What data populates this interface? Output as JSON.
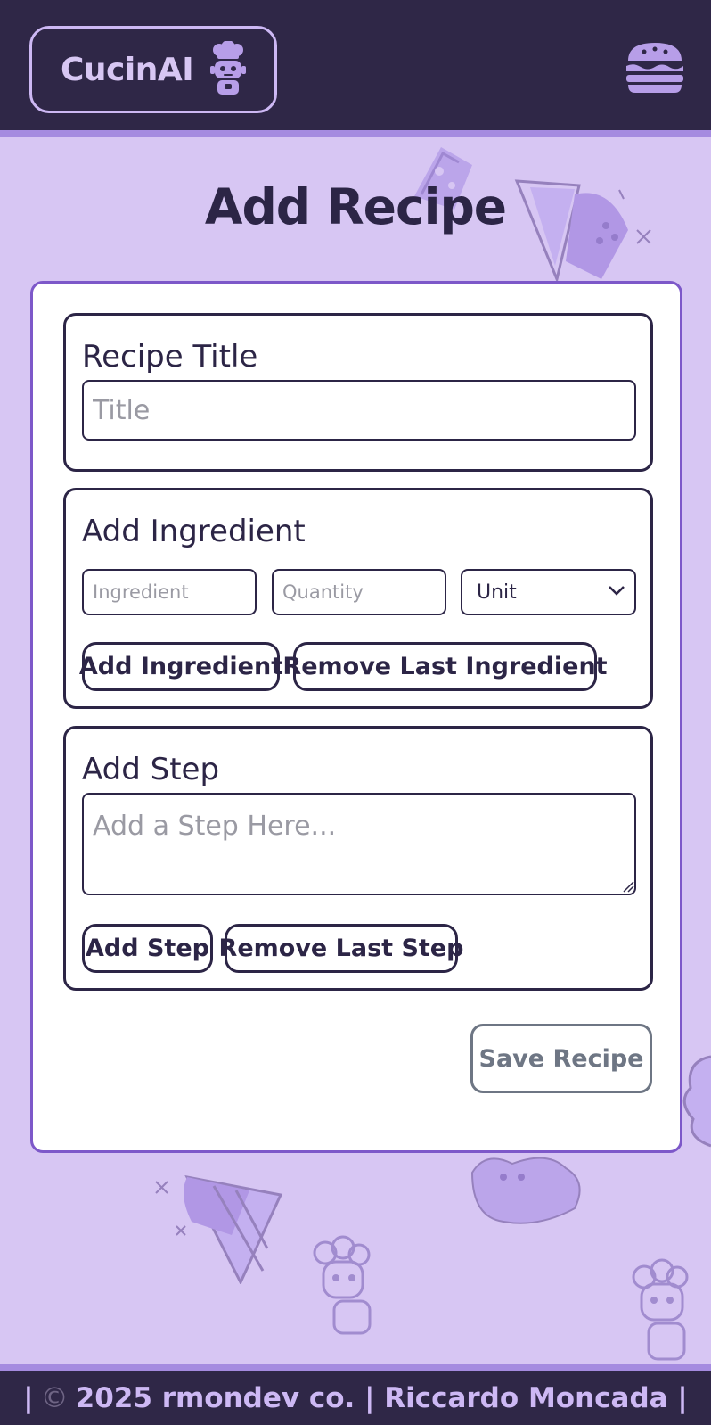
{
  "header": {
    "brand_name": "CucinAI",
    "brand_icon": "chef-icon",
    "menu_icon": "burger-menu-icon"
  },
  "page": {
    "title": "Add Recipe"
  },
  "recipe_title": {
    "label": "Recipe Title",
    "placeholder": "Title",
    "value": ""
  },
  "ingredient": {
    "label": "Add Ingredient",
    "ingredient_placeholder": "Ingredient",
    "quantity_placeholder": "Quantity",
    "unit_selected": "Unit",
    "add_label": "Add Ingredient",
    "remove_label": "Remove Last Ingredient"
  },
  "step": {
    "label": "Add Step",
    "placeholder": "Add a Step Here...",
    "add_label": "Add Step",
    "remove_label": "Remove Last Step"
  },
  "save_label": "Save Recipe",
  "footer": {
    "prefix": "|",
    "copyright_symbol": "©",
    "text": "2025 rmondev co. | Riccardo Moncada |"
  },
  "colors": {
    "header_bg": "#2f2747",
    "page_bg": "#d7c6f3",
    "accent": "#a58be0",
    "card_border": "#7d58c9",
    "text_dark": "#2c2546"
  }
}
